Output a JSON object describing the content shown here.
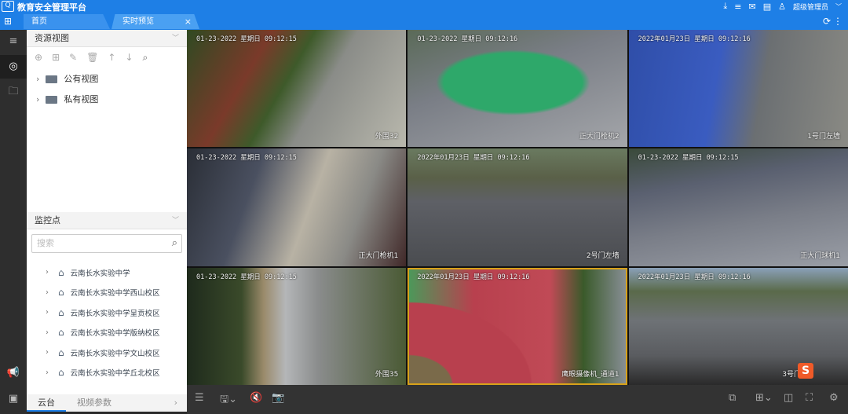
{
  "app": {
    "title": "教育安全管理平台",
    "logo_text": "Q"
  },
  "tabs": [
    {
      "label": "首页"
    },
    {
      "label": "实时预览",
      "close": "×"
    }
  ],
  "header": {
    "user": "超级管理员",
    "icons": [
      "download-icon",
      "list-icon",
      "mail-icon",
      "document-icon",
      "user-icon"
    ]
  },
  "resource_view": {
    "title": "资源视图",
    "items": [
      {
        "label": "公有视图"
      },
      {
        "label": "私有视图"
      }
    ]
  },
  "monitor": {
    "title": "监控点",
    "search_placeholder": "搜索",
    "sites": [
      {
        "label": "云南长水实验中学"
      },
      {
        "label": "云南长水实验中学西山校区"
      },
      {
        "label": "云南长水实验中学呈贡校区"
      },
      {
        "label": "云南长水实验中学版纳校区"
      },
      {
        "label": "云南长水实验中学文山校区"
      },
      {
        "label": "云南长水实验中学丘北校区"
      }
    ]
  },
  "panel_tabs": [
    {
      "label": "云台"
    },
    {
      "label": "视频参数"
    }
  ],
  "cameras": [
    {
      "time": "01-23-2022 星期日 09:12:15",
      "name": "外围32"
    },
    {
      "time": "01-23-2022 星期日 09:12:16",
      "name": "正大门枪机2"
    },
    {
      "time": "2022年01月23日 星期日 09:12:16",
      "name": "1号门左墙"
    },
    {
      "time": "01-23-2022 星期日 09:12:15",
      "name": "正大门枪机1"
    },
    {
      "time": "2022年01月23日 星期日 09:12:16",
      "name": "2号门左墙"
    },
    {
      "time": "01-23-2022 星期日 09:12:15",
      "name": "正大门球机1"
    },
    {
      "time": "01-23-2022 星期日 09:12:15",
      "name": "外围35"
    },
    {
      "time": "2022年01月23日 星期日 09:12:16",
      "name": "鹰眼摄像机_通道1"
    },
    {
      "time": "2022年01月23日 星期日 09:12:16",
      "name": "3号门"
    }
  ],
  "selected_camera": 7,
  "colors": {
    "brand": "#1e7fe6",
    "selected": "#d8a21a"
  }
}
